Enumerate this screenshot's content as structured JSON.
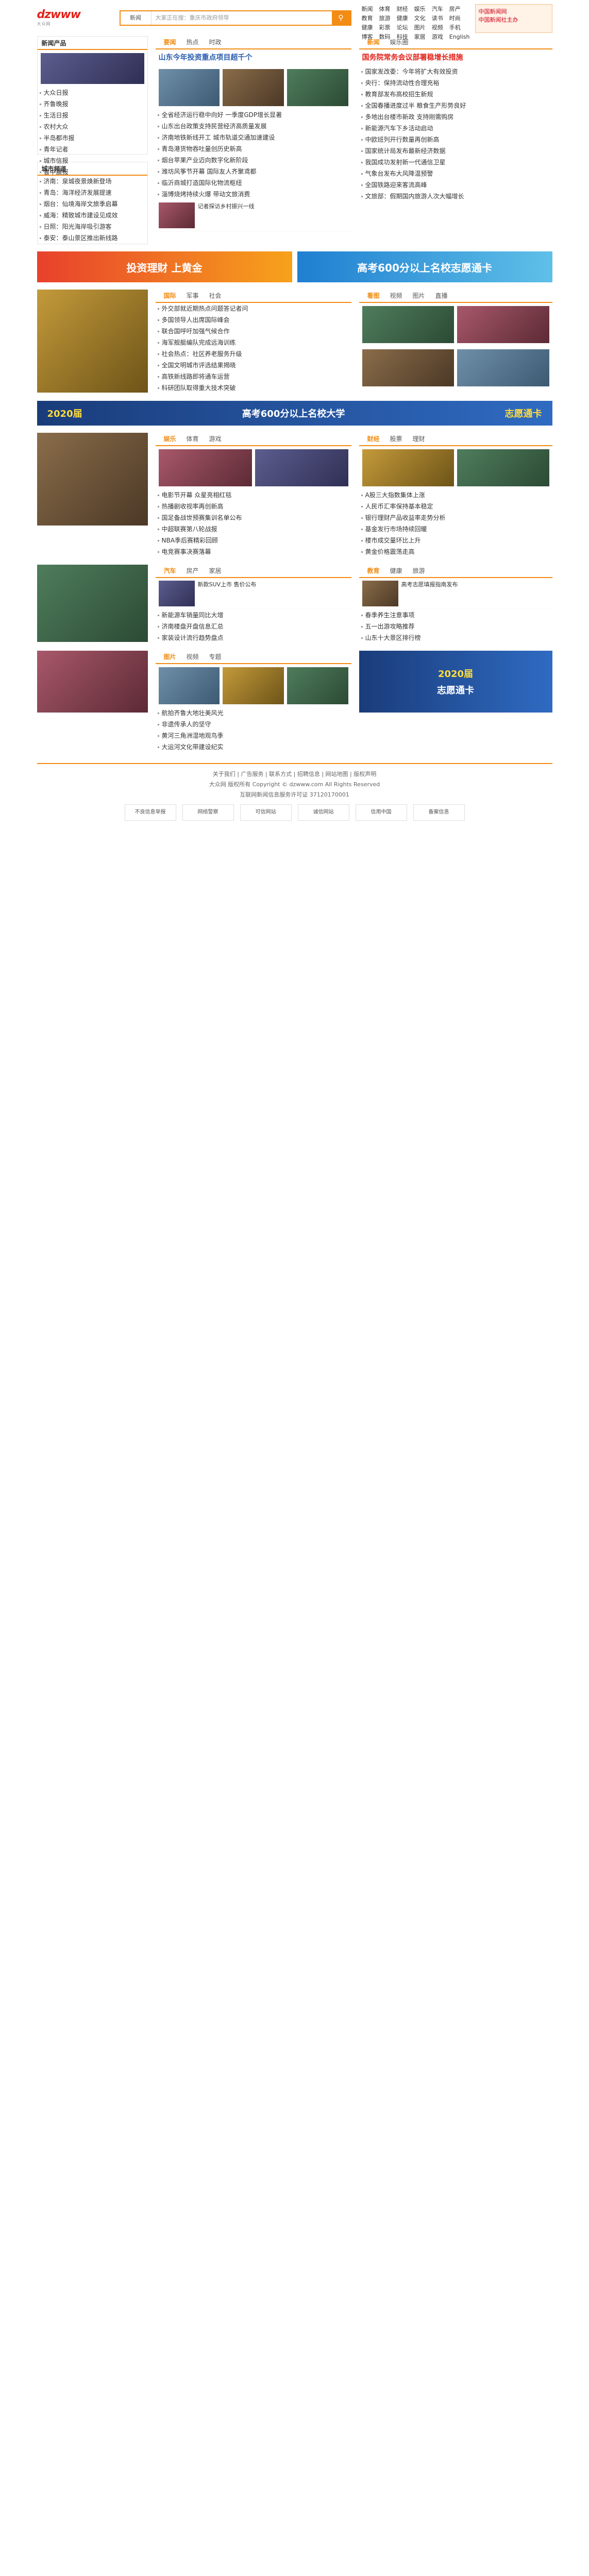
{
  "header": {
    "logo_text": "dzwww",
    "logo_sub": "大众网",
    "search_select": "新闻",
    "search_placeholder": "大家正在搜：重庆市政府领导",
    "top_links": [
      "新闻",
      "体育",
      "财经",
      "娱乐",
      "汽车",
      "房产",
      "教育",
      "旅游",
      "健康",
      "文化",
      "读书",
      "时尚",
      "健康",
      "彩票",
      "论坛",
      "图片",
      "视频",
      "手机",
      "博客",
      "数码",
      "科技",
      "家居",
      "游戏",
      "English"
    ],
    "ad_line1": "中国新闻网",
    "ad_line2": "中国新闻社主办"
  },
  "sections": {
    "left_top_title": "新闻产品",
    "left_top_items": [
      "大众日报",
      "齐鲁晚报",
      "生活日报",
      "农村大众",
      "半岛都市报",
      "青年记者",
      "城市信报",
      "鲁中晨报"
    ],
    "main_tabs": [
      "要闻",
      "热点",
      "时政"
    ],
    "main_headline": "山东今年投资重点项目超千个",
    "main_list": [
      "全省经济运行稳中向好 一季度GDP增长显著",
      "山东出台政策支持民营经济高质量发展",
      "济南地铁新线开工 城市轨道交通加速建设",
      "青岛港货物吞吐量创历史新高",
      "烟台苹果产业迈向数字化新阶段",
      "潍坊风筝节开幕 国际友人齐聚鸢都",
      "临沂商城打造国际化物流枢纽",
      "淄博烧烤持续火爆 带动文旅消费"
    ],
    "right_tabs": [
      "新闻",
      "娱乐圈"
    ],
    "right_headline": "国务院常务会议部署稳增长措施",
    "right_list": [
      "国家发改委：今年将扩大有效投资",
      "央行：保持流动性合理充裕",
      "教育部发布高校招生新规",
      "全国春播进度过半 粮食生产形势良好",
      "多地出台楼市新政 支持刚需购房",
      "新能源汽车下乡活动启动",
      "中欧班列开行数量再创新高",
      "国家统计局发布最新经济数据",
      "我国成功发射新一代通信卫星",
      "气象台发布大风降温预警",
      "全国铁路迎来客流高峰",
      "文旅部：假期国内旅游人次大幅增长"
    ],
    "section2_title": "城市频道",
    "section2_list": [
      "济南：泉城夜景焕新登场",
      "青岛：海洋经济发展提速",
      "烟台：仙境海岸文旅季启幕",
      "威海：精致城市建设见成效",
      "日照：阳光海岸吸引游客",
      "泰安：泰山景区推出新线路"
    ],
    "feature_tabs": [
      "看图",
      "视频",
      "图片",
      "直播"
    ],
    "feature_caption": "记者探访乡村振兴一线",
    "section3_tabs": [
      "国际",
      "军事",
      "社会"
    ],
    "section3_list": [
      "外交部就近期热点问题答记者问",
      "多国领导人出席国际峰会",
      "联合国呼吁加强气候合作",
      "海军舰艇编队完成远海训练",
      "社会热点：社区养老服务升级",
      "全国文明城市评选结果揭晓",
      "高铁新线路即将通车运营",
      "科研团队取得重大技术突破"
    ],
    "banner_left": "投资理财 上黄金",
    "banner_right": "高考600分以上名校志愿通卡",
    "ent_tabs": [
      "娱乐",
      "体育",
      "游戏"
    ],
    "ent_list": [
      "电影节开幕 众星亮相红毯",
      "热播剧收视率再创新高",
      "国足备战世预赛集训名单公布",
      "中超联赛第八轮战报",
      "NBA季后赛精彩回顾",
      "电竞赛事决赛落幕"
    ],
    "finance_tabs": [
      "财经",
      "股票",
      "理财"
    ],
    "finance_list": [
      "A股三大指数集体上涨",
      "人民币汇率保持基本稳定",
      "银行理财产品收益率走势分析",
      "基金发行市场持续回暖",
      "楼市成交量环比上升",
      "黄金价格震荡走高"
    ],
    "auto_tabs": [
      "汽车",
      "房产",
      "家居"
    ],
    "auto_list": [
      "新款SUV上市 售价公布",
      "新能源车销量同比大增",
      "济南楼盘开盘信息汇总",
      "家装设计流行趋势盘点"
    ],
    "edu_tabs": [
      "教育",
      "健康",
      "旅游"
    ],
    "edu_list": [
      "高考志愿填报指南发布",
      "春季养生注意事项",
      "五一出游攻略推荐",
      "山东十大景区排行榜"
    ],
    "bottom_tabs": [
      "图片",
      "视频",
      "专题"
    ],
    "bottom_list": [
      "航拍齐鲁大地壮美风光",
      "非遗传承人的坚守",
      "黄河三角洲湿地观鸟季",
      "大运河文化带建设纪实"
    ],
    "big_ad_left": "2020届",
    "big_ad_mid": "高考600分以上名校大学",
    "big_ad_right": "志愿通卡"
  },
  "footer": {
    "links": "关于我们 | 广告服务 | 联系方式 | 招聘信息 | 网站地图 | 版权声明",
    "copyright": "大众网 版权所有 Copyright © dzwww.com All Rights Reserved",
    "license": "互联网新闻信息服务许可证 37120170001",
    "badges": [
      "不良信息举报",
      "网络警察",
      "可信网站",
      "诚信网站",
      "信用中国",
      "备案信息"
    ]
  }
}
